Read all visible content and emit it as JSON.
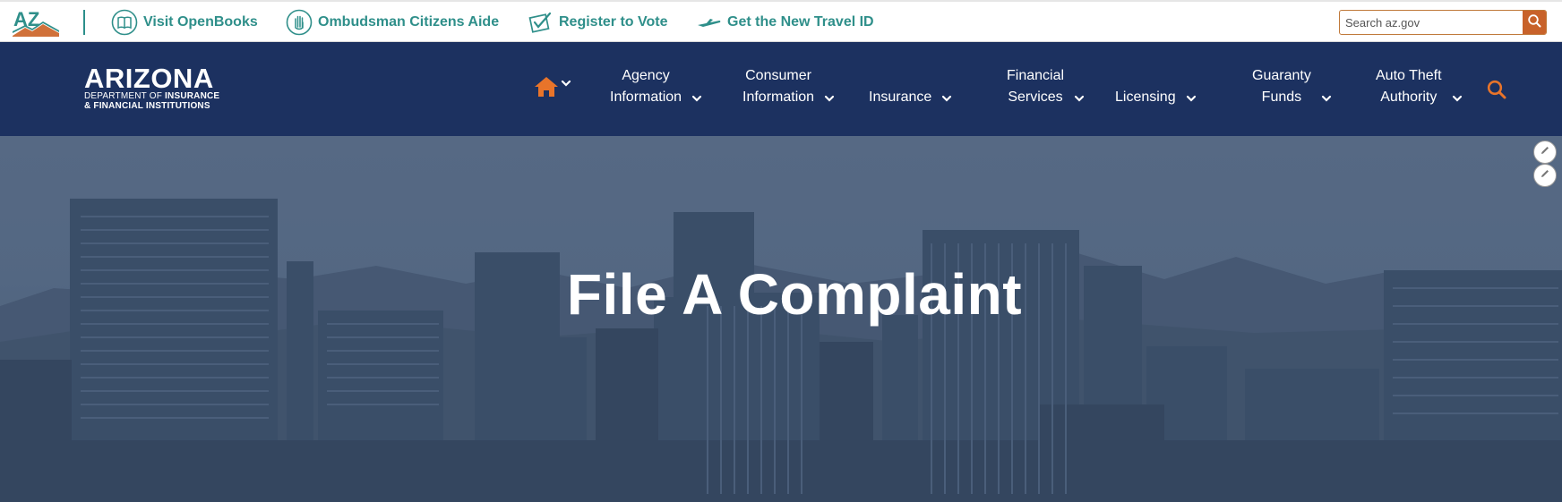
{
  "topbar": {
    "logo_text": "AZ",
    "links": [
      {
        "label": "Visit OpenBooks",
        "icon": "open-book-icon"
      },
      {
        "label": "Ombudsman Citizens Aide",
        "icon": "raised-hand-icon"
      },
      {
        "label": "Register to Vote",
        "icon": "ballot-check-icon"
      },
      {
        "label": "Get the New Travel ID",
        "icon": "airplane-icon"
      }
    ],
    "search_placeholder": "Search az.gov"
  },
  "brand": {
    "name": "ARIZONA",
    "line1_prefix": "DEPARTMENT OF",
    "line1_bold": "INSURANCE",
    "line2": "& FINANCIAL INSTITUTIONS"
  },
  "nav": {
    "items": [
      {
        "line1": "Agency",
        "line2": "Information"
      },
      {
        "line1": "Consumer",
        "line2": "Information"
      },
      {
        "line1": "",
        "line2": "Insurance"
      },
      {
        "line1": "Financial",
        "line2": "Services"
      },
      {
        "line1": "",
        "line2": "Licensing"
      },
      {
        "line1": "Guaranty",
        "line2": "Funds"
      },
      {
        "line1": "Auto Theft",
        "line2": "Authority"
      }
    ]
  },
  "hero": {
    "title": "File A Complaint"
  },
  "colors": {
    "teal": "#2f8f8a",
    "navy": "#1c3160",
    "orange": "#e8742a"
  }
}
